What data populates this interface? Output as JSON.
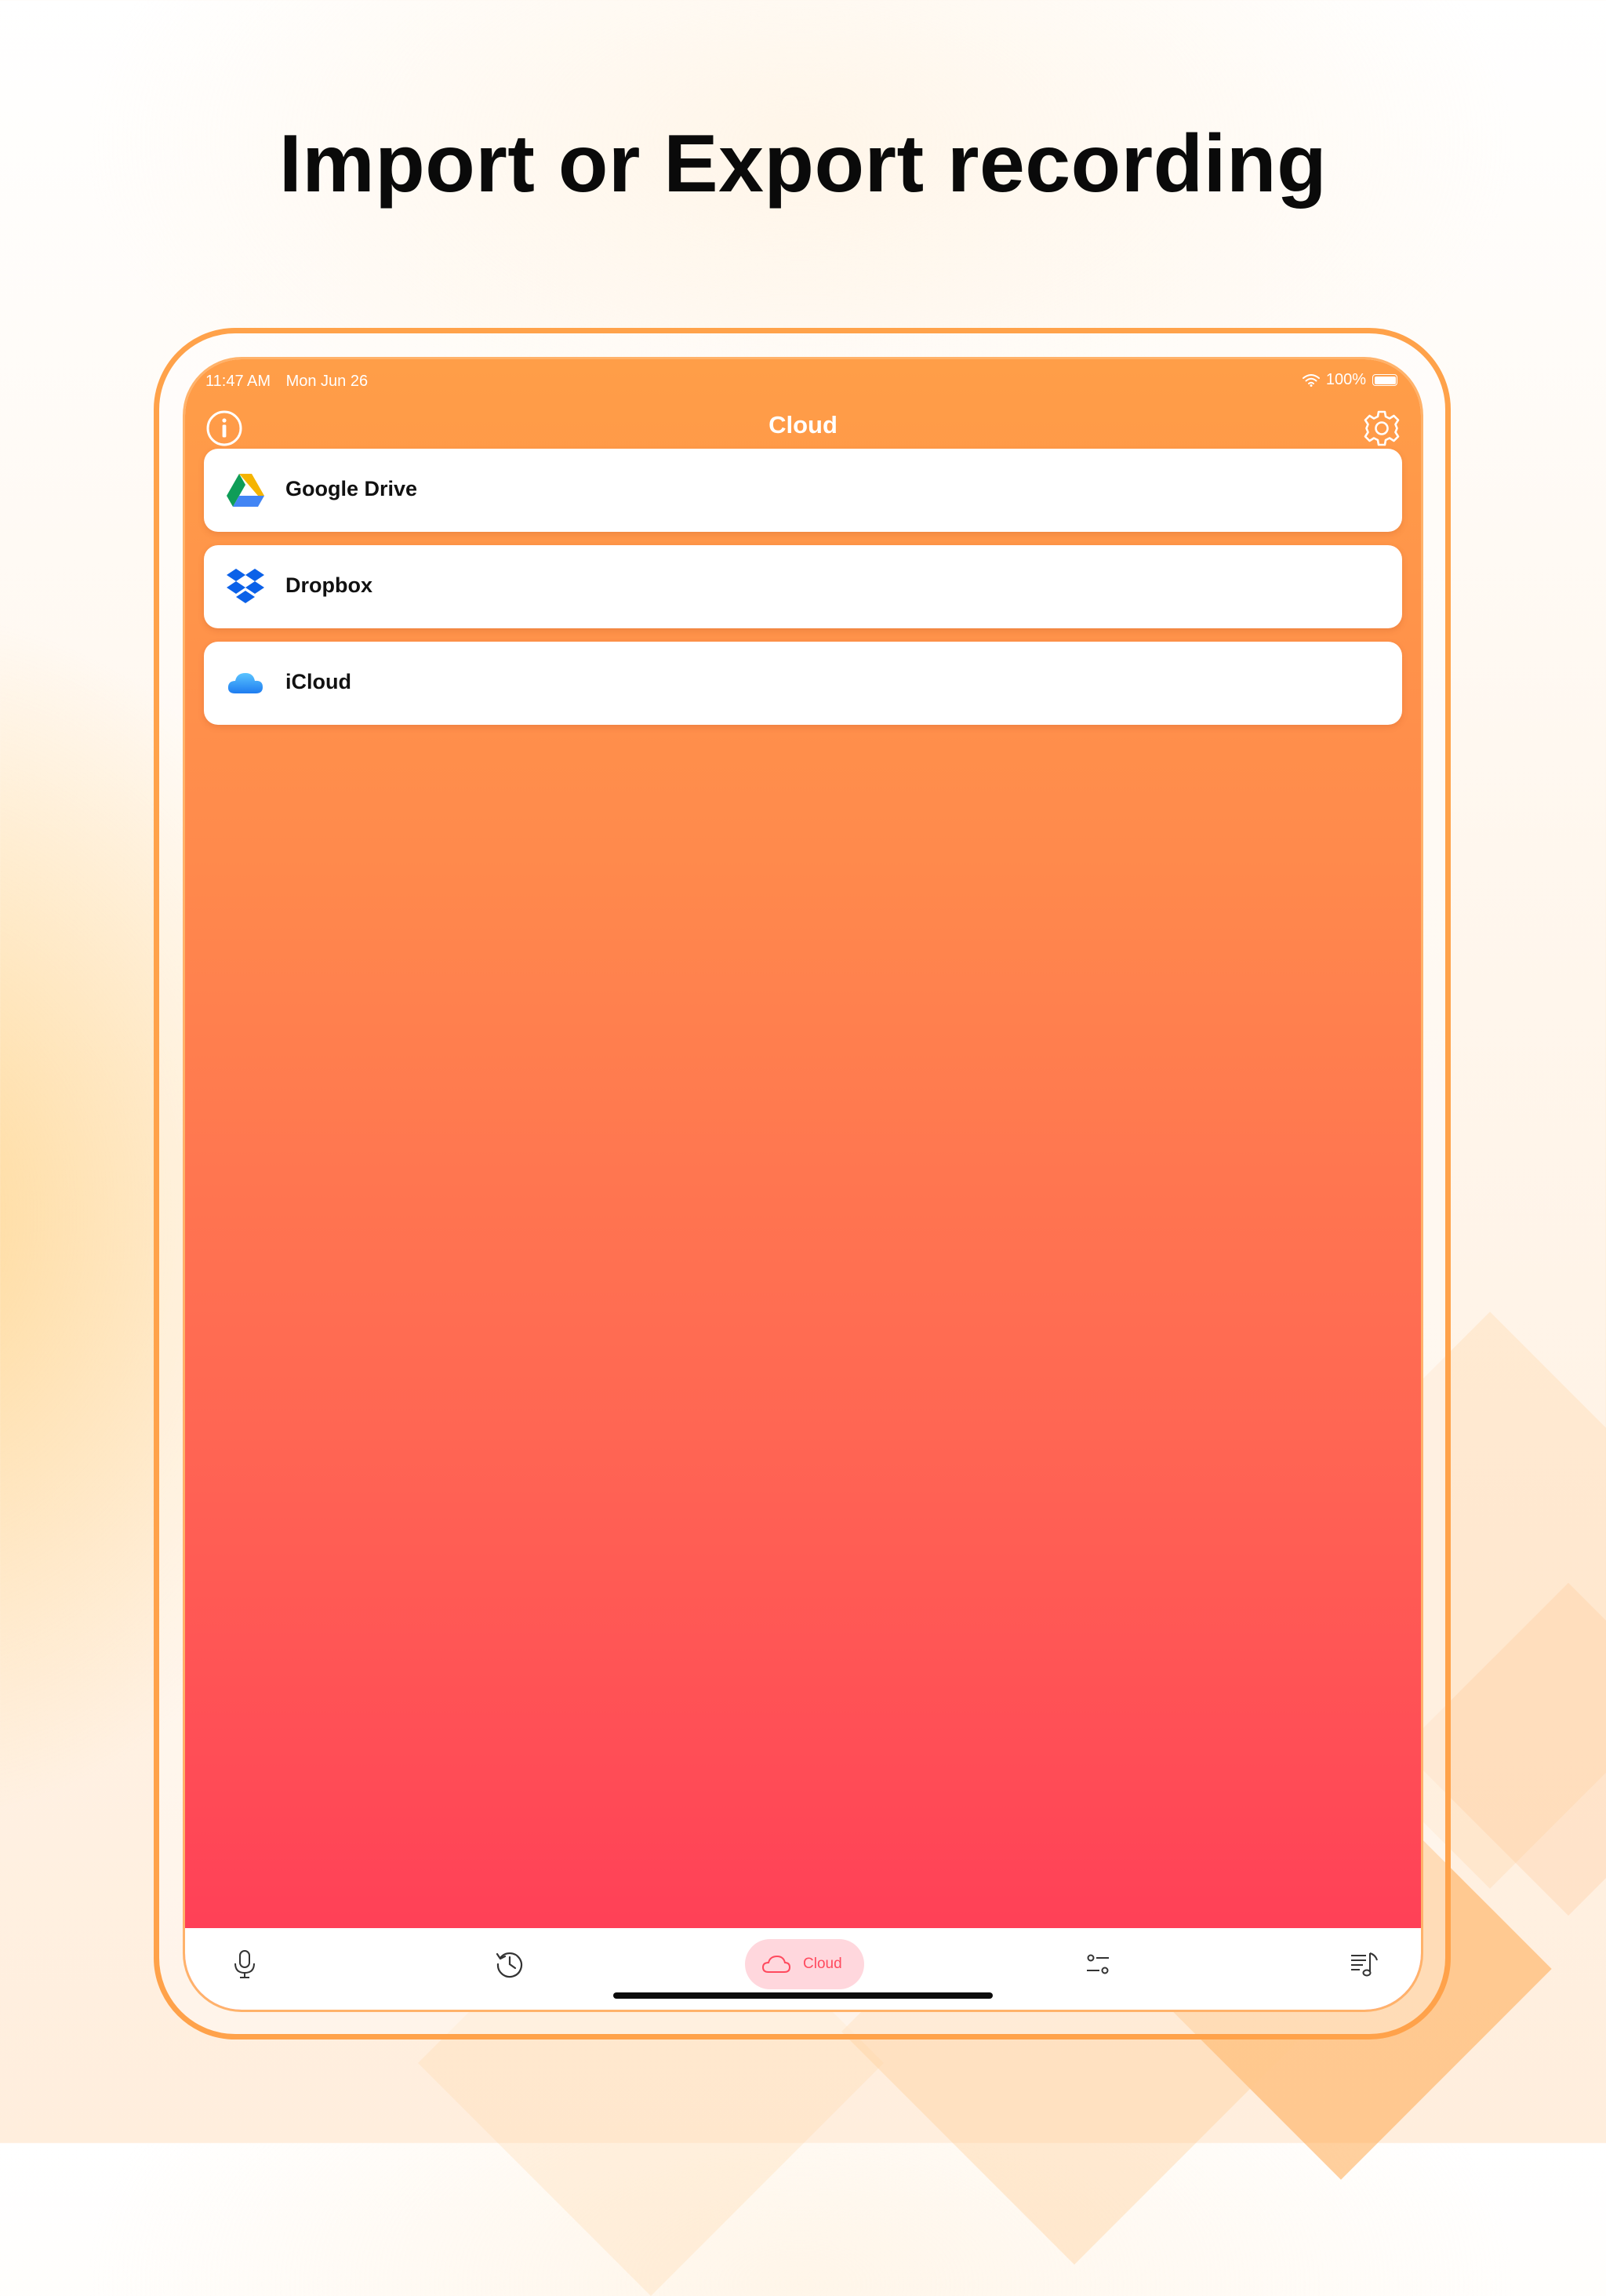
{
  "headline": "Import or Export recording",
  "status_bar": {
    "time": "11:47 AM",
    "date": "Mon Jun 26",
    "battery": "100%"
  },
  "navbar": {
    "title": "Cloud",
    "info_icon": "info-icon",
    "settings_icon": "gear-icon"
  },
  "services": [
    {
      "label": "Google Drive",
      "icon": "google-drive-icon"
    },
    {
      "label": "Dropbox",
      "icon": "dropbox-icon"
    },
    {
      "label": "iCloud",
      "icon": "icloud-icon"
    }
  ],
  "tabbar": {
    "active_tab": "cloud",
    "items": [
      {
        "id": "record",
        "icon": "microphone-icon"
      },
      {
        "id": "history",
        "icon": "history-icon"
      },
      {
        "id": "cloud",
        "icon": "cloud-icon",
        "label": "Cloud"
      },
      {
        "id": "settings",
        "icon": "sliders-icon"
      },
      {
        "id": "playlist",
        "icon": "playlist-music-icon"
      }
    ]
  },
  "colors": {
    "accent": "#ff9e48",
    "gradient_top": "#ff9e48",
    "gradient_bottom": "#ff3a58",
    "active_tab_bg": "#ffd7dd",
    "active_tab_fg": "#ff4a5e"
  }
}
